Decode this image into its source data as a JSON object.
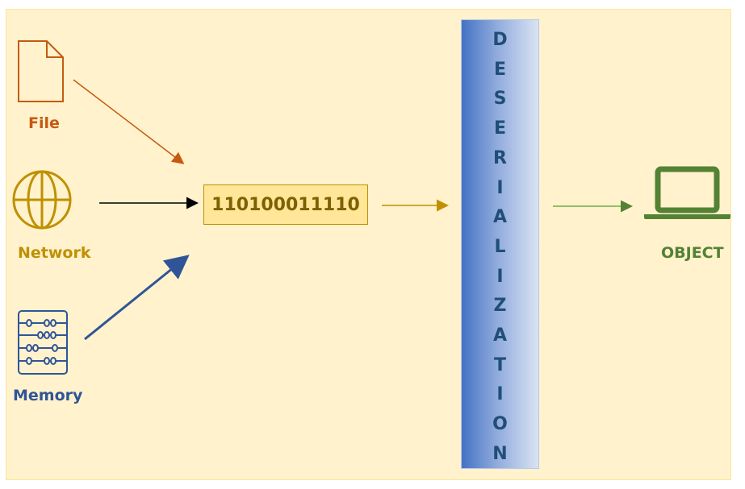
{
  "sources": {
    "file": {
      "label": "File",
      "icon": "file-icon",
      "color": "#c55a11"
    },
    "network": {
      "label": "Network",
      "icon": "globe-icon",
      "color": "#bf9000"
    },
    "memory": {
      "label": "Memory",
      "icon": "abacus-icon",
      "color": "#2f5597"
    }
  },
  "bytestream": {
    "value": "110100011110"
  },
  "process": {
    "label": "DESERIALIZATION",
    "letters": [
      "D",
      "E",
      "S",
      "E",
      "R",
      "I",
      "A",
      "L",
      "I",
      "Z",
      "A",
      "T",
      "I",
      "O",
      "N"
    ]
  },
  "target": {
    "label": "OBJECT",
    "icon": "laptop-icon",
    "color": "#538135"
  },
  "arrow_colors": {
    "file": "#c55a11",
    "network": "#000000",
    "memory": "#2f5597",
    "bytes": "#bf9000",
    "object": "#70ad47"
  }
}
